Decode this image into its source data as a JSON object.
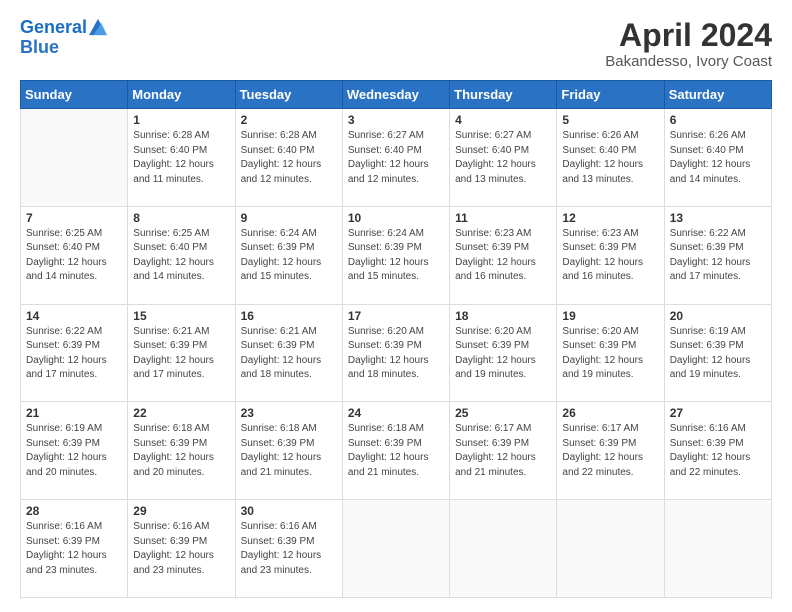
{
  "header": {
    "logo_line1": "General",
    "logo_line2": "Blue",
    "title": "April 2024",
    "subtitle": "Bakandesso, Ivory Coast"
  },
  "weekdays": [
    "Sunday",
    "Monday",
    "Tuesday",
    "Wednesday",
    "Thursday",
    "Friday",
    "Saturday"
  ],
  "weeks": [
    [
      {
        "day": "",
        "info": ""
      },
      {
        "day": "1",
        "info": "Sunrise: 6:28 AM\nSunset: 6:40 PM\nDaylight: 12 hours\nand 11 minutes."
      },
      {
        "day": "2",
        "info": "Sunrise: 6:28 AM\nSunset: 6:40 PM\nDaylight: 12 hours\nand 12 minutes."
      },
      {
        "day": "3",
        "info": "Sunrise: 6:27 AM\nSunset: 6:40 PM\nDaylight: 12 hours\nand 12 minutes."
      },
      {
        "day": "4",
        "info": "Sunrise: 6:27 AM\nSunset: 6:40 PM\nDaylight: 12 hours\nand 13 minutes."
      },
      {
        "day": "5",
        "info": "Sunrise: 6:26 AM\nSunset: 6:40 PM\nDaylight: 12 hours\nand 13 minutes."
      },
      {
        "day": "6",
        "info": "Sunrise: 6:26 AM\nSunset: 6:40 PM\nDaylight: 12 hours\nand 14 minutes."
      }
    ],
    [
      {
        "day": "7",
        "info": "Sunrise: 6:25 AM\nSunset: 6:40 PM\nDaylight: 12 hours\nand 14 minutes."
      },
      {
        "day": "8",
        "info": "Sunrise: 6:25 AM\nSunset: 6:40 PM\nDaylight: 12 hours\nand 14 minutes."
      },
      {
        "day": "9",
        "info": "Sunrise: 6:24 AM\nSunset: 6:39 PM\nDaylight: 12 hours\nand 15 minutes."
      },
      {
        "day": "10",
        "info": "Sunrise: 6:24 AM\nSunset: 6:39 PM\nDaylight: 12 hours\nand 15 minutes."
      },
      {
        "day": "11",
        "info": "Sunrise: 6:23 AM\nSunset: 6:39 PM\nDaylight: 12 hours\nand 16 minutes."
      },
      {
        "day": "12",
        "info": "Sunrise: 6:23 AM\nSunset: 6:39 PM\nDaylight: 12 hours\nand 16 minutes."
      },
      {
        "day": "13",
        "info": "Sunrise: 6:22 AM\nSunset: 6:39 PM\nDaylight: 12 hours\nand 17 minutes."
      }
    ],
    [
      {
        "day": "14",
        "info": "Sunrise: 6:22 AM\nSunset: 6:39 PM\nDaylight: 12 hours\nand 17 minutes."
      },
      {
        "day": "15",
        "info": "Sunrise: 6:21 AM\nSunset: 6:39 PM\nDaylight: 12 hours\nand 17 minutes."
      },
      {
        "day": "16",
        "info": "Sunrise: 6:21 AM\nSunset: 6:39 PM\nDaylight: 12 hours\nand 18 minutes."
      },
      {
        "day": "17",
        "info": "Sunrise: 6:20 AM\nSunset: 6:39 PM\nDaylight: 12 hours\nand 18 minutes."
      },
      {
        "day": "18",
        "info": "Sunrise: 6:20 AM\nSunset: 6:39 PM\nDaylight: 12 hours\nand 19 minutes."
      },
      {
        "day": "19",
        "info": "Sunrise: 6:20 AM\nSunset: 6:39 PM\nDaylight: 12 hours\nand 19 minutes."
      },
      {
        "day": "20",
        "info": "Sunrise: 6:19 AM\nSunset: 6:39 PM\nDaylight: 12 hours\nand 19 minutes."
      }
    ],
    [
      {
        "day": "21",
        "info": "Sunrise: 6:19 AM\nSunset: 6:39 PM\nDaylight: 12 hours\nand 20 minutes."
      },
      {
        "day": "22",
        "info": "Sunrise: 6:18 AM\nSunset: 6:39 PM\nDaylight: 12 hours\nand 20 minutes."
      },
      {
        "day": "23",
        "info": "Sunrise: 6:18 AM\nSunset: 6:39 PM\nDaylight: 12 hours\nand 21 minutes."
      },
      {
        "day": "24",
        "info": "Sunrise: 6:18 AM\nSunset: 6:39 PM\nDaylight: 12 hours\nand 21 minutes."
      },
      {
        "day": "25",
        "info": "Sunrise: 6:17 AM\nSunset: 6:39 PM\nDaylight: 12 hours\nand 21 minutes."
      },
      {
        "day": "26",
        "info": "Sunrise: 6:17 AM\nSunset: 6:39 PM\nDaylight: 12 hours\nand 22 minutes."
      },
      {
        "day": "27",
        "info": "Sunrise: 6:16 AM\nSunset: 6:39 PM\nDaylight: 12 hours\nand 22 minutes."
      }
    ],
    [
      {
        "day": "28",
        "info": "Sunrise: 6:16 AM\nSunset: 6:39 PM\nDaylight: 12 hours\nand 23 minutes."
      },
      {
        "day": "29",
        "info": "Sunrise: 6:16 AM\nSunset: 6:39 PM\nDaylight: 12 hours\nand 23 minutes."
      },
      {
        "day": "30",
        "info": "Sunrise: 6:16 AM\nSunset: 6:39 PM\nDaylight: 12 hours\nand 23 minutes."
      },
      {
        "day": "",
        "info": ""
      },
      {
        "day": "",
        "info": ""
      },
      {
        "day": "",
        "info": ""
      },
      {
        "day": "",
        "info": ""
      }
    ]
  ]
}
